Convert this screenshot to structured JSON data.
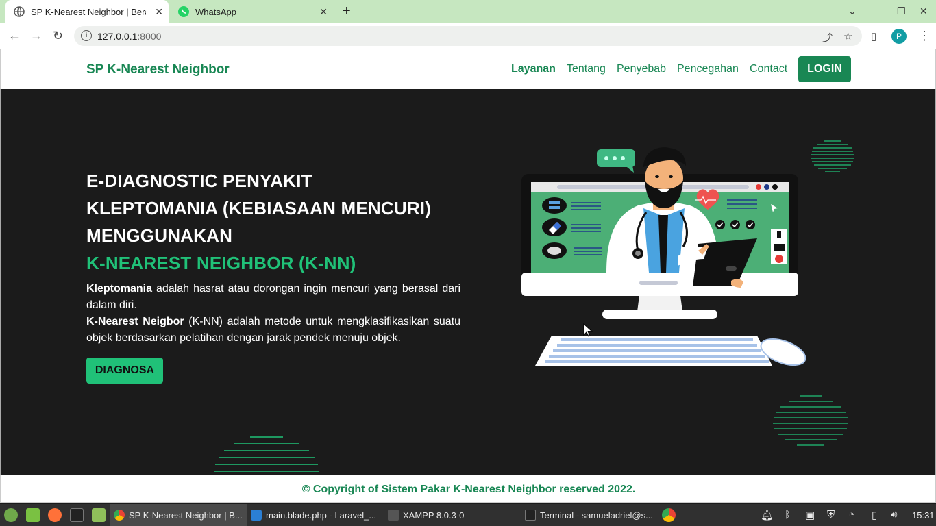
{
  "browser": {
    "tabs": [
      {
        "title": "SP K-Nearest Neighbor | Beran",
        "active": true
      },
      {
        "title": "WhatsApp",
        "active": false
      }
    ],
    "new_tab_icon": "+",
    "url_host": "127.0.0.1",
    "url_port": ":8000",
    "profile_initial": "P"
  },
  "site": {
    "brand": "SP K-Nearest Neighbor",
    "nav": [
      {
        "label": "Layanan",
        "active": true
      },
      {
        "label": "Tentang",
        "active": false
      },
      {
        "label": "Penyebab",
        "active": false
      },
      {
        "label": "Pencegahan",
        "active": false
      },
      {
        "label": "Contact",
        "active": false
      }
    ],
    "login_label": "LOGIN",
    "colors": {
      "brand_green": "#198754",
      "accent_green": "#20c178",
      "hero_bg": "#1b1b1b"
    }
  },
  "hero": {
    "title_line1": "E-DIAGNOSTIC PENYAKIT",
    "title_line2": "KLEPTOMANIA (KEBIASAAN MENCURI)",
    "title_line3": "MENGGUNAKAN",
    "title_line4": "K-NEAREST NEIGHBOR (K-NN)",
    "term1": "Kleptomania",
    "def1": " adalah hasrat atau dorongan ingin mencuri yang berasal dari dalam diri.",
    "term2": "K-Nearest Neigbor",
    "def2": " (K-NN) adalah metode untuk mengklasifikasikan suatu objek berdasarkan pelatihan dengan jarak pendek menuju objek.",
    "button_label": "DIAGNOSA"
  },
  "footer": {
    "text": "© Copyright of Sistem Pakar K-Nearest Neighbor reserved 2022."
  },
  "taskbar": {
    "tasks": [
      {
        "label": "SP K-Nearest Neighbor | B...",
        "icon": "chrome-icon",
        "active": true
      },
      {
        "label": "main.blade.php - Laravel_...",
        "icon": "vscode-icon",
        "active": false
      },
      {
        "label": "XAMPP 8.0.3-0",
        "icon": "xampp-icon",
        "active": false
      },
      {
        "label": "Terminal - samueladriel@s...",
        "icon": "terminal-icon",
        "active": false
      }
    ],
    "clock": "15:31"
  }
}
